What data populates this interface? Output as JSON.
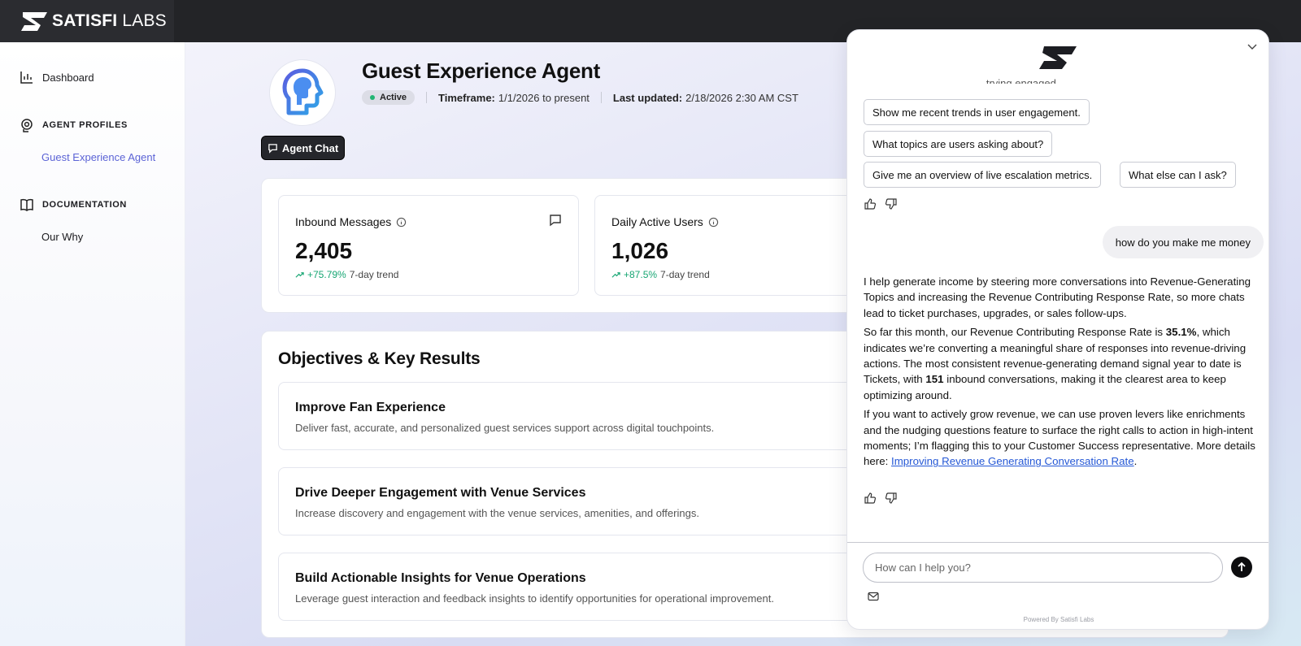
{
  "brand": {
    "name_bold": "SATISFI",
    "name_light": " LABS"
  },
  "sidebar": {
    "dashboard": "Dashboard",
    "agent_profiles_heading": "AGENT PROFILES",
    "agent_profiles_item": "Guest Experience Agent",
    "documentation_heading": "DOCUMENTATION",
    "documentation_item": "Our Why"
  },
  "header": {
    "title": "Guest Experience Agent",
    "status": "Active",
    "timeframe_label": "Timeframe:",
    "timeframe_value": "1/1/2026 to present",
    "updated_label": "Last updated:",
    "updated_value": "2/18/2026 2:30 AM CST",
    "agent_chat_label": "Agent Chat"
  },
  "metrics": [
    {
      "label": "Inbound Messages",
      "value": "2,405",
      "trend": "+75.79%",
      "trend_label": "7-day trend"
    },
    {
      "label": "Daily Active Users",
      "value": "1,026",
      "trend": "+87.5%",
      "trend_label": "7-day trend"
    }
  ],
  "okr": {
    "title": "Objectives & Key Results",
    "items": [
      {
        "title": "Improve Fan Experience",
        "desc": "Deliver fast, accurate, and personalized guest services support across digital touchpoints."
      },
      {
        "title": "Drive Deeper Engagement with Venue Services",
        "desc": "Increase discovery and engagement with the venue services, amenities, and offerings."
      },
      {
        "title": "Build Actionable Insights for Venue Operations",
        "desc": "Leverage guest interaction and feedback insights to identify opportunities for operational improvement."
      }
    ]
  },
  "chat": {
    "faded_line": "...trying engaged...",
    "chips": [
      "Show me recent trends in user engagement.",
      "What topics are users asking about?",
      "Give me an overview of live escalation metrics.",
      "What else can I ask?"
    ],
    "user_message": "how do you make me money",
    "bot": {
      "p1": "I help generate income by steering more conversations into Revenue-Generating Topics and increasing the Revenue Contributing Response Rate, so more chats lead to ticket purchases, upgrades, or sales follow-ups.",
      "p2_a": "So far this month, our Revenue Contributing Response Rate is ",
      "p2_rate": "35.1%",
      "p2_b": ", which indicates we’re converting a meaningful share of responses into revenue-driving actions. The most consistent revenue-generating demand signal year to date is Tickets, with ",
      "p2_count": "151",
      "p2_c": " inbound conversations, making it the clearest area to keep optimizing around.",
      "p3": "If you want to actively grow revenue, we can use proven levers like enrichments and the nudging questions feature to surface the right calls to action in high-intent moments; I’m flagging this to your Customer Success representative. More details here: ",
      "link": "Improving Revenue Generating Conversation Rate",
      "p3_end": "."
    },
    "input_placeholder": "How can I help you?",
    "powered_by": "Powered By Satisfi Labs"
  }
}
